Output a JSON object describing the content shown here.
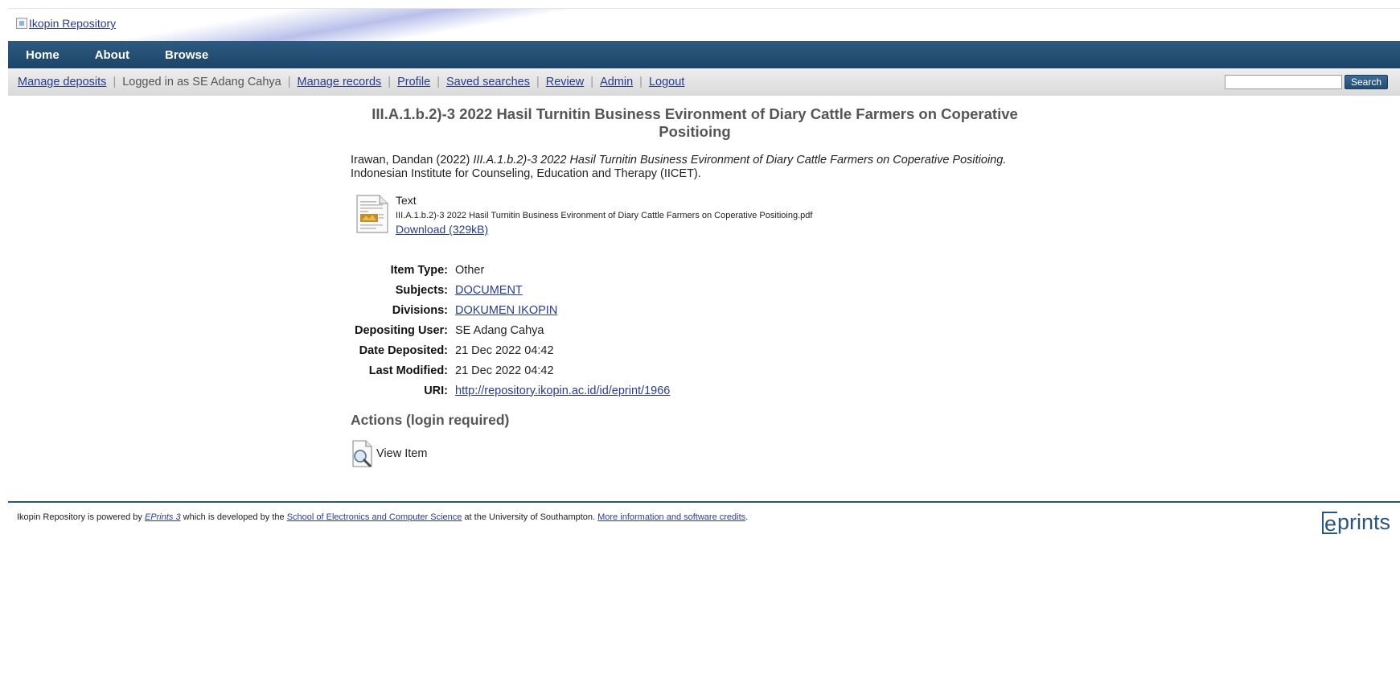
{
  "header": {
    "logo_alt": "Ikopin Repository"
  },
  "nav": {
    "items": [
      {
        "label": "Home"
      },
      {
        "label": "About"
      },
      {
        "label": "Browse"
      }
    ]
  },
  "toolbar": {
    "manage_deposits": "Manage deposits",
    "logged_in_as": "Logged in as SE Adang Cahya",
    "manage_records": "Manage records",
    "profile": "Profile",
    "saved_searches": "Saved searches",
    "review": "Review",
    "admin": "Admin",
    "logout": "Logout",
    "separator": "|",
    "search_value": "",
    "search_button": "Search"
  },
  "eprint": {
    "title_line1": "III.A.1.b.2)-3 2022 Hasil Turnitin Business Evironment of Diary Cattle Farmers on Coperative",
    "title_line2": "Positioing",
    "citation_authors": "Irawan, Dandan (2022) ",
    "citation_title": "III.A.1.b.2)-3 2022 Hasil Turnitin Business Evironment of Diary Cattle Farmers on Coperative Positioing.",
    "citation_publisher": "Indonesian Institute for Counseling, Education and Therapy (IICET).",
    "document": {
      "type": "Text",
      "filename": "III.A.1.b.2)-3 2022 Hasil Turnitin Business Evironment of Diary Cattle Farmers on Coperative Positioing.pdf",
      "download_label": "Download (329kB)"
    },
    "metadata": [
      {
        "label": "Item Type:",
        "value": "Other",
        "link": false
      },
      {
        "label": "Subjects:",
        "value": "DOCUMENT",
        "link": true
      },
      {
        "label": "Divisions:",
        "value": "DOKUMEN IKOPIN",
        "link": true
      },
      {
        "label": "Depositing User:",
        "value": "SE Adang Cahya",
        "link": false
      },
      {
        "label": "Date Deposited:",
        "value": "21 Dec 2022 04:42",
        "link": false
      },
      {
        "label": "Last Modified:",
        "value": "21 Dec 2022 04:42",
        "link": false
      },
      {
        "label": "URI:",
        "value": "http://repository.ikopin.ac.id/id/eprint/1966",
        "link": true
      }
    ],
    "actions_title": "Actions (login required)",
    "view_item": "View Item"
  },
  "footer": {
    "text1": "Ikopin Repository is powered by ",
    "eprints_link": "EPrints 3",
    "text2": " which is developed by the ",
    "school_link": "School of Electronics and Computer Science",
    "text3": " at the University of Southampton. ",
    "more_link": "More information and software credits",
    "text4": ".",
    "logo_e": "e",
    "logo_rest": "prints"
  },
  "colors": {
    "nav_bar": "#1c4468",
    "link": "#2a3c8c",
    "footer_line": "#2b5579"
  }
}
